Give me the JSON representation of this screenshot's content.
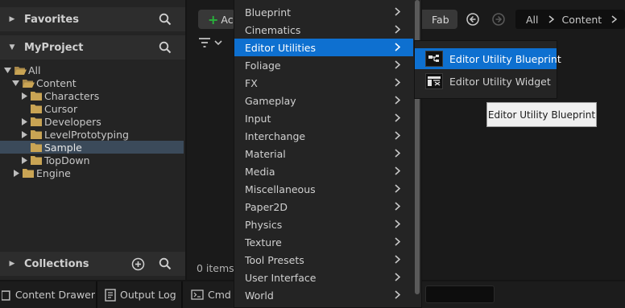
{
  "left_panel": {
    "favorites": {
      "title": "Favorites"
    },
    "project": {
      "title": "MyProject"
    },
    "collections": {
      "title": "Collections"
    },
    "tree": [
      {
        "label": "All"
      },
      {
        "label": "Content"
      },
      {
        "label": "Characters"
      },
      {
        "label": "Cursor"
      },
      {
        "label": "Developers"
      },
      {
        "label": "LevelPrototyping"
      },
      {
        "label": "Sample"
      },
      {
        "label": "TopDown"
      },
      {
        "label": "Engine"
      }
    ]
  },
  "toolbar": {
    "add_label": "Ac",
    "fab_label": "Fab",
    "breadcrumb": {
      "root": "All",
      "current": "Content"
    }
  },
  "content": {
    "item_count": "0 items"
  },
  "bottom_bar": {
    "content_drawer": "Content Drawer",
    "output_log": "Output Log",
    "cmd": "Cmd"
  },
  "context_menu": {
    "items": [
      {
        "label": "Blueprint"
      },
      {
        "label": "Cinematics"
      },
      {
        "label": "Editor Utilities"
      },
      {
        "label": "Foliage"
      },
      {
        "label": "FX"
      },
      {
        "label": "Gameplay"
      },
      {
        "label": "Input"
      },
      {
        "label": "Interchange"
      },
      {
        "label": "Material"
      },
      {
        "label": "Media"
      },
      {
        "label": "Miscellaneous"
      },
      {
        "label": "Paper2D"
      },
      {
        "label": "Physics"
      },
      {
        "label": "Texture"
      },
      {
        "label": "Tool Presets"
      },
      {
        "label": "User Interface"
      },
      {
        "label": "World"
      }
    ],
    "highlighted": "Editor Utilities"
  },
  "submenu": {
    "items": [
      {
        "label": "Editor Utility Blueprint",
        "icon": "editor-utility-blueprint-icon"
      },
      {
        "label": "Editor Utility Widget",
        "icon": "editor-utility-widget-icon"
      }
    ]
  },
  "tooltip": {
    "text": "Editor Utility Blueprint"
  },
  "colors": {
    "highlight": "#0e70d0",
    "folder": "#c9a454",
    "add_plus": "#27b33b",
    "selection_row": "#3b4a5a"
  }
}
